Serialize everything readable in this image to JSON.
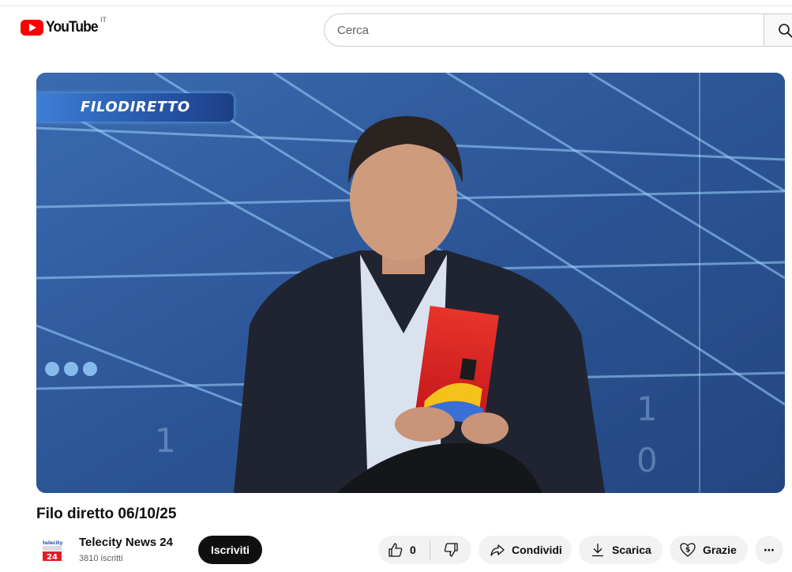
{
  "header": {
    "logo_text": "YouTube",
    "country_code": "IT",
    "search_placeholder": "Cerca"
  },
  "video": {
    "overlay_tag": "FILODIRETTO",
    "title": "Filo diretto 06/10/25"
  },
  "channel": {
    "name": "Telecity News 24",
    "subscribers": "3810 iscritti",
    "subscribe_label": "Iscriviti"
  },
  "actions": {
    "like_count": "0",
    "share_label": "Condividi",
    "download_label": "Scarica",
    "thanks_label": "Grazie",
    "more_label": "⋯"
  },
  "colors": {
    "brand_red": "#ff0000",
    "subscribe_bg": "#0f0f0f",
    "pill_bg": "#f2f2f2",
    "player_blue": "#2a4f8a"
  }
}
